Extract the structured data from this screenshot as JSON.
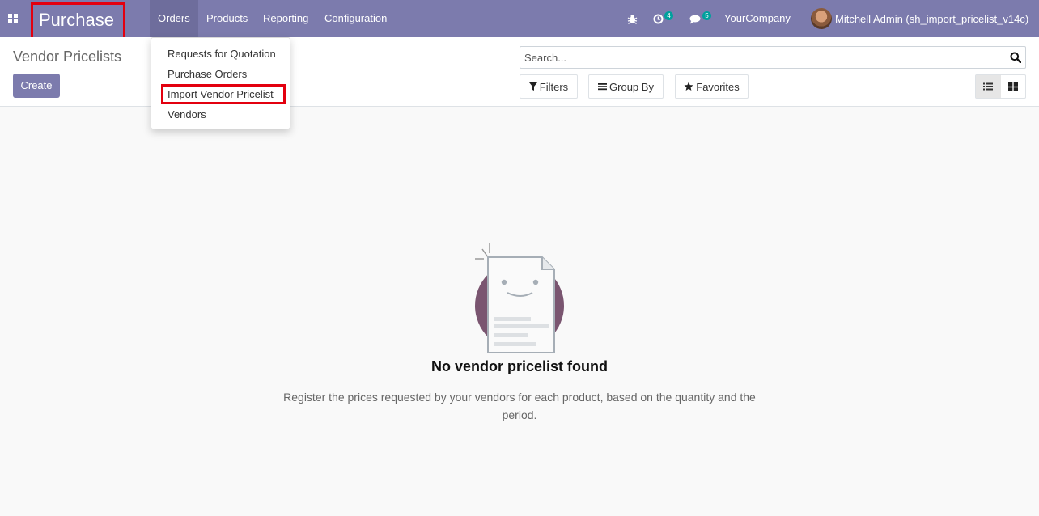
{
  "navbar": {
    "app_name": "Purchase",
    "menu": [
      "Orders",
      "Products",
      "Reporting",
      "Configuration"
    ],
    "activity_count": "4",
    "message_count": "5",
    "company": "YourCompany",
    "user": "Mitchell Admin (sh_import_pricelist_v14c)"
  },
  "control_panel": {
    "title": "Vendor Pricelists",
    "create_label": "Create",
    "search_placeholder": "Search...",
    "filters_label": "Filters",
    "group_by_label": "Group By",
    "favorites_label": "Favorites"
  },
  "orders_menu": {
    "items": [
      "Requests for Quotation",
      "Purchase Orders",
      "Import Vendor Pricelist",
      "Vendors"
    ]
  },
  "empty_state": {
    "title": "No vendor pricelist found",
    "text": "Register the prices requested by your vendors for each product, based on the quantity and the period."
  },
  "colors": {
    "navbar": "#7c7bad",
    "highlight": "#e3000f",
    "badge": "#00a09d"
  },
  "icons": [
    "apps-icon",
    "bug-icon",
    "activity-icon",
    "chat-icon",
    "search-icon",
    "filter-icon",
    "list-icon",
    "star-icon",
    "list-view-icon",
    "kanban-view-icon"
  ]
}
